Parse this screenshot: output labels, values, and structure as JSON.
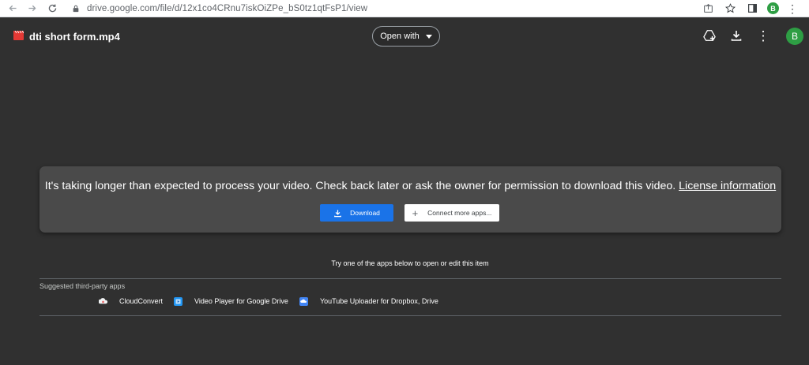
{
  "browser": {
    "url": "drive.google.com/file/d/12x1co4CRnu7iskOiZPe_bS0tz1qtFsP1/view",
    "profile_initial": "B"
  },
  "topbar": {
    "file_name": "dti short form.mp4",
    "open_with_label": "Open with",
    "avatar_initial": "B"
  },
  "message": {
    "text": "It's taking longer than expected to process your video. Check back later or ask the owner for permission to download this video.",
    "link": "License information",
    "download_label": "Download",
    "connect_label": "Connect more apps..."
  },
  "apps": {
    "hint": "Try one of the apps below to open or edit this item",
    "suggested_label": "Suggested third-party apps",
    "items": [
      {
        "label": "CloudConvert",
        "icon": "cloudconvert-icon",
        "color": "#e86a6a"
      },
      {
        "label": "Video Player for Google Drive",
        "icon": "video-player-icon",
        "color": "#2196f3"
      },
      {
        "label": "YouTube Uploader for Dropbox, Drive",
        "icon": "youtube-uploader-icon",
        "color": "#4285f4"
      }
    ]
  },
  "colors": {
    "background": "#303030",
    "card": "#4a4a4a",
    "primary": "#1a73e8",
    "avatar": "#2e9e44"
  }
}
